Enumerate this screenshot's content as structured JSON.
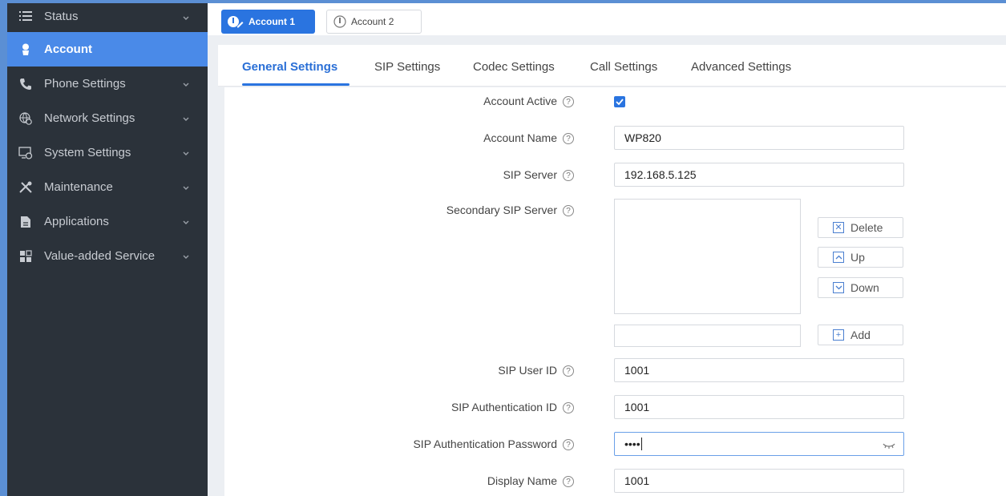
{
  "sidebar": {
    "items": [
      {
        "label": "Status",
        "icon": "list-icon",
        "active": false,
        "chevron": true
      },
      {
        "label": "Account",
        "icon": "user-icon",
        "active": true,
        "chevron": false
      },
      {
        "label": "Phone Settings",
        "icon": "phone-icon",
        "active": false,
        "chevron": true
      },
      {
        "label": "Network Settings",
        "icon": "network-gear-icon",
        "active": false,
        "chevron": true
      },
      {
        "label": "System Settings",
        "icon": "system-gear-icon",
        "active": false,
        "chevron": true
      },
      {
        "label": "Maintenance",
        "icon": "tools-icon",
        "active": false,
        "chevron": true
      },
      {
        "label": "Applications",
        "icon": "document-icon",
        "active": false,
        "chevron": true
      },
      {
        "label": "Value-added Service",
        "icon": "apps-grid-icon",
        "active": false,
        "chevron": true
      }
    ]
  },
  "account_tabs": [
    {
      "label": "Account 1",
      "active": true
    },
    {
      "label": "Account 2",
      "active": false
    }
  ],
  "sub_tabs": [
    {
      "label": "General Settings",
      "active": true
    },
    {
      "label": "SIP Settings",
      "active": false
    },
    {
      "label": "Codec Settings",
      "active": false
    },
    {
      "label": "Call Settings",
      "active": false
    },
    {
      "label": "Advanced Settings",
      "active": false
    }
  ],
  "form": {
    "account_active": {
      "label": "Account Active",
      "checked": true
    },
    "account_name": {
      "label": "Account Name",
      "value": "WP820"
    },
    "sip_server": {
      "label": "SIP Server",
      "value": "192.168.5.125"
    },
    "secondary_sip_server": {
      "label": "Secondary SIP Server",
      "items": [],
      "new_value": ""
    },
    "sip_user_id": {
      "label": "SIP User ID",
      "value": "1001"
    },
    "sip_auth_id": {
      "label": "SIP Authentication ID",
      "value": "1001"
    },
    "sip_auth_password": {
      "label": "SIP Authentication Password",
      "masked": "••••"
    },
    "display_name": {
      "label": "Display Name",
      "value": "1001"
    }
  },
  "list_buttons": {
    "delete": "Delete",
    "up": "Up",
    "down": "Down",
    "add": "Add"
  },
  "colors": {
    "accent": "#2a74e0",
    "sidebar_bg": "#2b323a",
    "sidebar_active": "#4a8ae8"
  }
}
